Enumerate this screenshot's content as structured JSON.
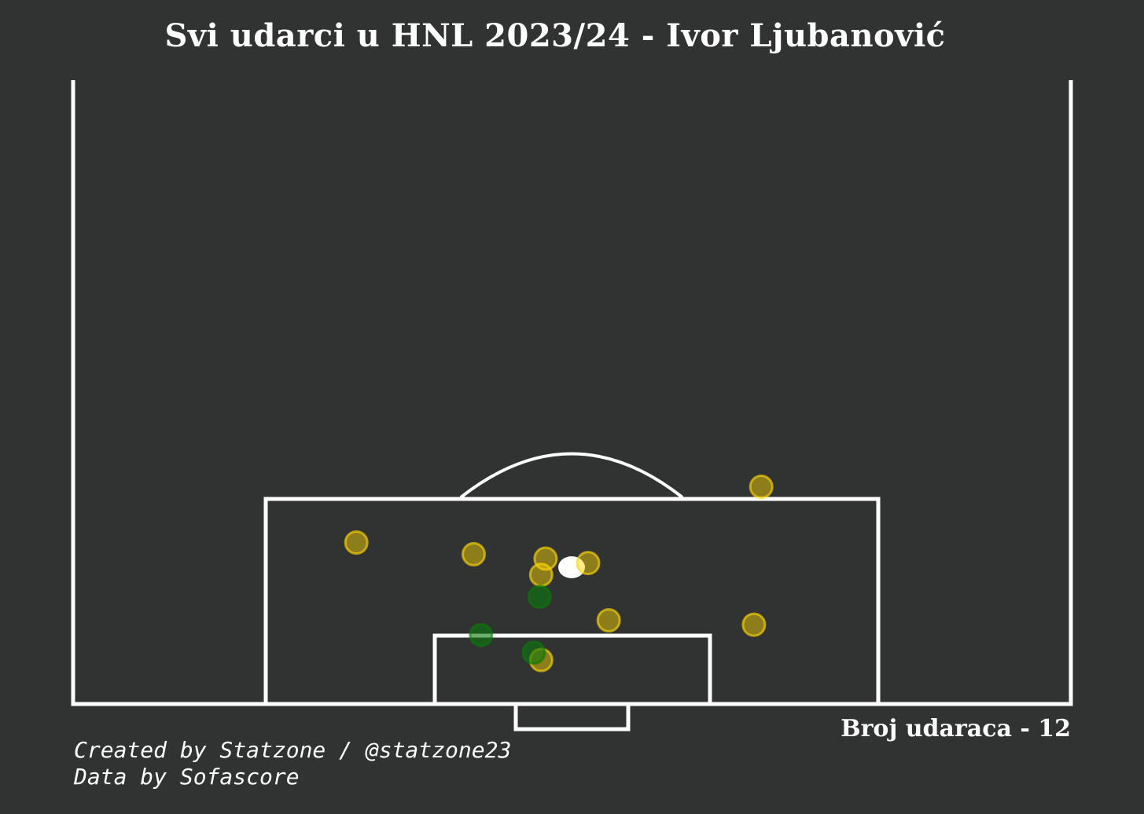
{
  "title": "Svi udarci u HNL 2023/24 - Ivor Ljubanović",
  "shot_count_label": "Broj udaraca - 12",
  "credits": {
    "created_by": "Created by Statzone / @statzone23",
    "data_by": "Data by Sofascore"
  },
  "colors": {
    "background": "#313332",
    "lines": "#ffffff",
    "shot_default": "#ffd700",
    "shot_goal": "#0a7a0a",
    "penalty_spot": "#ffffff"
  },
  "chart_data": {
    "type": "scatter",
    "title": "Svi udarci u HNL 2023/24 - Ivor Ljubanović",
    "xlabel": "",
    "ylabel": "",
    "xlim": [
      -34,
      34
    ],
    "ylim": [
      0,
      42.5
    ],
    "grid": false,
    "total_shots": 12,
    "series": [
      {
        "category": "shot",
        "color": "#ffd700",
        "points": [
          {
            "x": -14.7,
            "y": 11.0
          },
          {
            "x": -6.7,
            "y": 10.2
          },
          {
            "x": -1.8,
            "y": 9.9
          },
          {
            "x": 1.1,
            "y": 9.6
          },
          {
            "x": -2.1,
            "y": 8.8
          },
          {
            "x": 2.5,
            "y": 5.7
          },
          {
            "x": 12.9,
            "y": 14.8
          },
          {
            "x": 12.4,
            "y": 5.4
          },
          {
            "x": -2.1,
            "y": 3.0
          }
        ]
      },
      {
        "category": "goal",
        "color": "#0a7a0a",
        "points": [
          {
            "x": -2.2,
            "y": 7.3
          },
          {
            "x": -6.2,
            "y": 4.7
          },
          {
            "x": -2.6,
            "y": 3.5
          }
        ]
      }
    ]
  }
}
